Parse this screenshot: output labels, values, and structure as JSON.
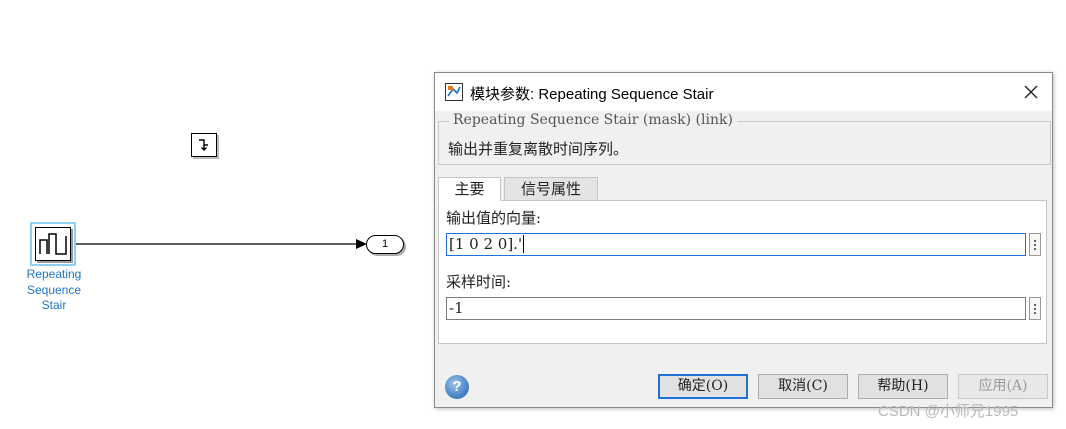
{
  "canvas": {
    "block": {
      "label_lines": [
        "Repeating",
        "Sequence",
        "Stair"
      ]
    },
    "outport": {
      "number": "1"
    },
    "zoh_block": {
      "icon": "zoh-step-icon"
    }
  },
  "dialog": {
    "title": "模块参数: Repeating Sequence Stair",
    "description": {
      "legend": "Repeating Sequence Stair (mask) (link)",
      "text": "输出并重复离散时间序列。"
    },
    "tabs": [
      {
        "label": "主要",
        "active": true
      },
      {
        "label": "信号属性",
        "active": false
      }
    ],
    "fields": [
      {
        "label": "输出值的向量:",
        "value": "[1 0 2 0].'"
      },
      {
        "label": "采样时间:",
        "value": "-1"
      }
    ],
    "buttons": {
      "help": "?",
      "ok": "确定(O)",
      "cancel": "取消(C)",
      "help_label": "帮助(H)",
      "apply": "应用(A)"
    }
  },
  "watermark": "CSDN @小师兄1995",
  "colors": {
    "block_label": "#1d74c9",
    "selection": "#8fd0f2",
    "focus": "#1c72d5"
  }
}
